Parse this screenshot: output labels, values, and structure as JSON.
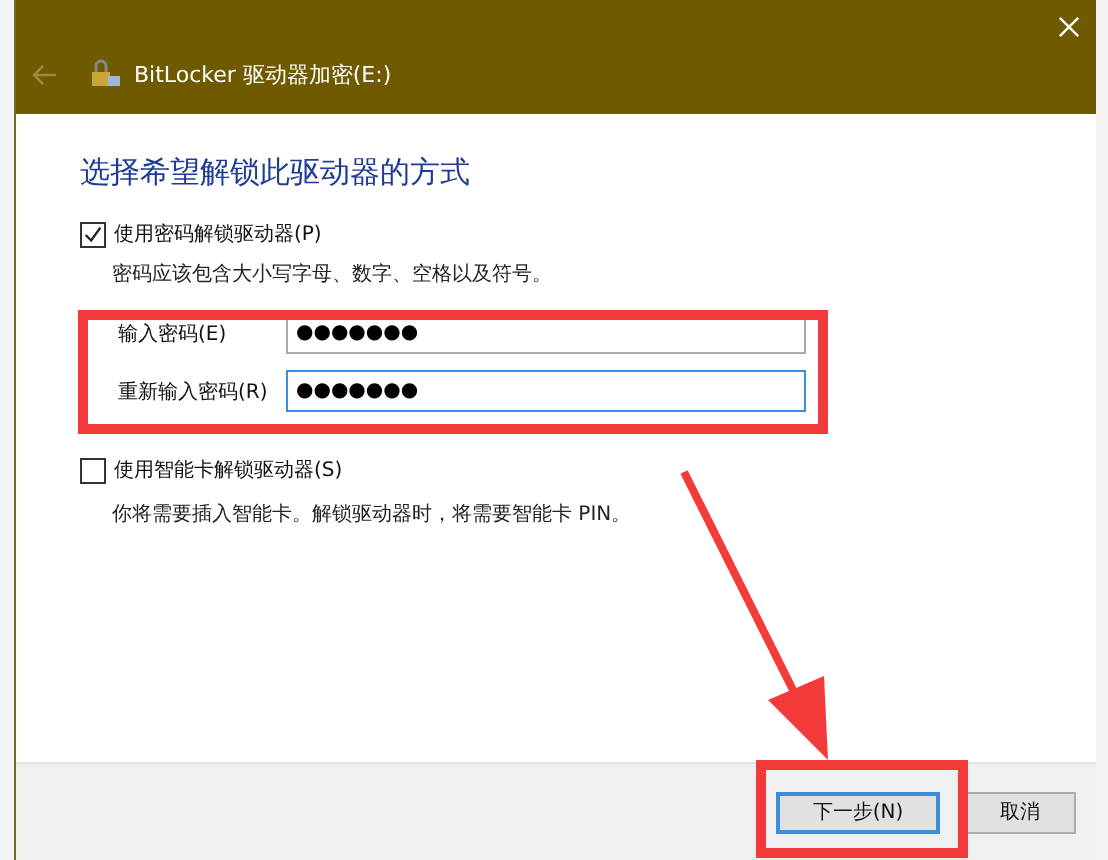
{
  "window": {
    "title": "BitLocker 驱动器加密(E:)"
  },
  "heading": "选择希望解锁此驱动器的方式",
  "options": [
    {
      "kind": "password",
      "label": "使用密码解锁驱动器(P)",
      "checked": true,
      "hint": "密码应该包含大小写字母、数字、空格以及符号。",
      "fields": [
        {
          "label": "输入密码(E)",
          "value": "●●●●●●●",
          "focused": false
        },
        {
          "label": "重新输入密码(R)",
          "value": "●●●●●●●",
          "focused": true
        }
      ]
    },
    {
      "kind": "smartcard",
      "label": "使用智能卡解锁驱动器(S)",
      "checked": false,
      "hint": "你将需要插入智能卡。解锁驱动器时，将需要智能卡 PIN。"
    }
  ],
  "buttons": [
    {
      "label": "下一步(N)",
      "selected": true
    },
    {
      "label": "取消",
      "selected": false
    }
  ]
}
